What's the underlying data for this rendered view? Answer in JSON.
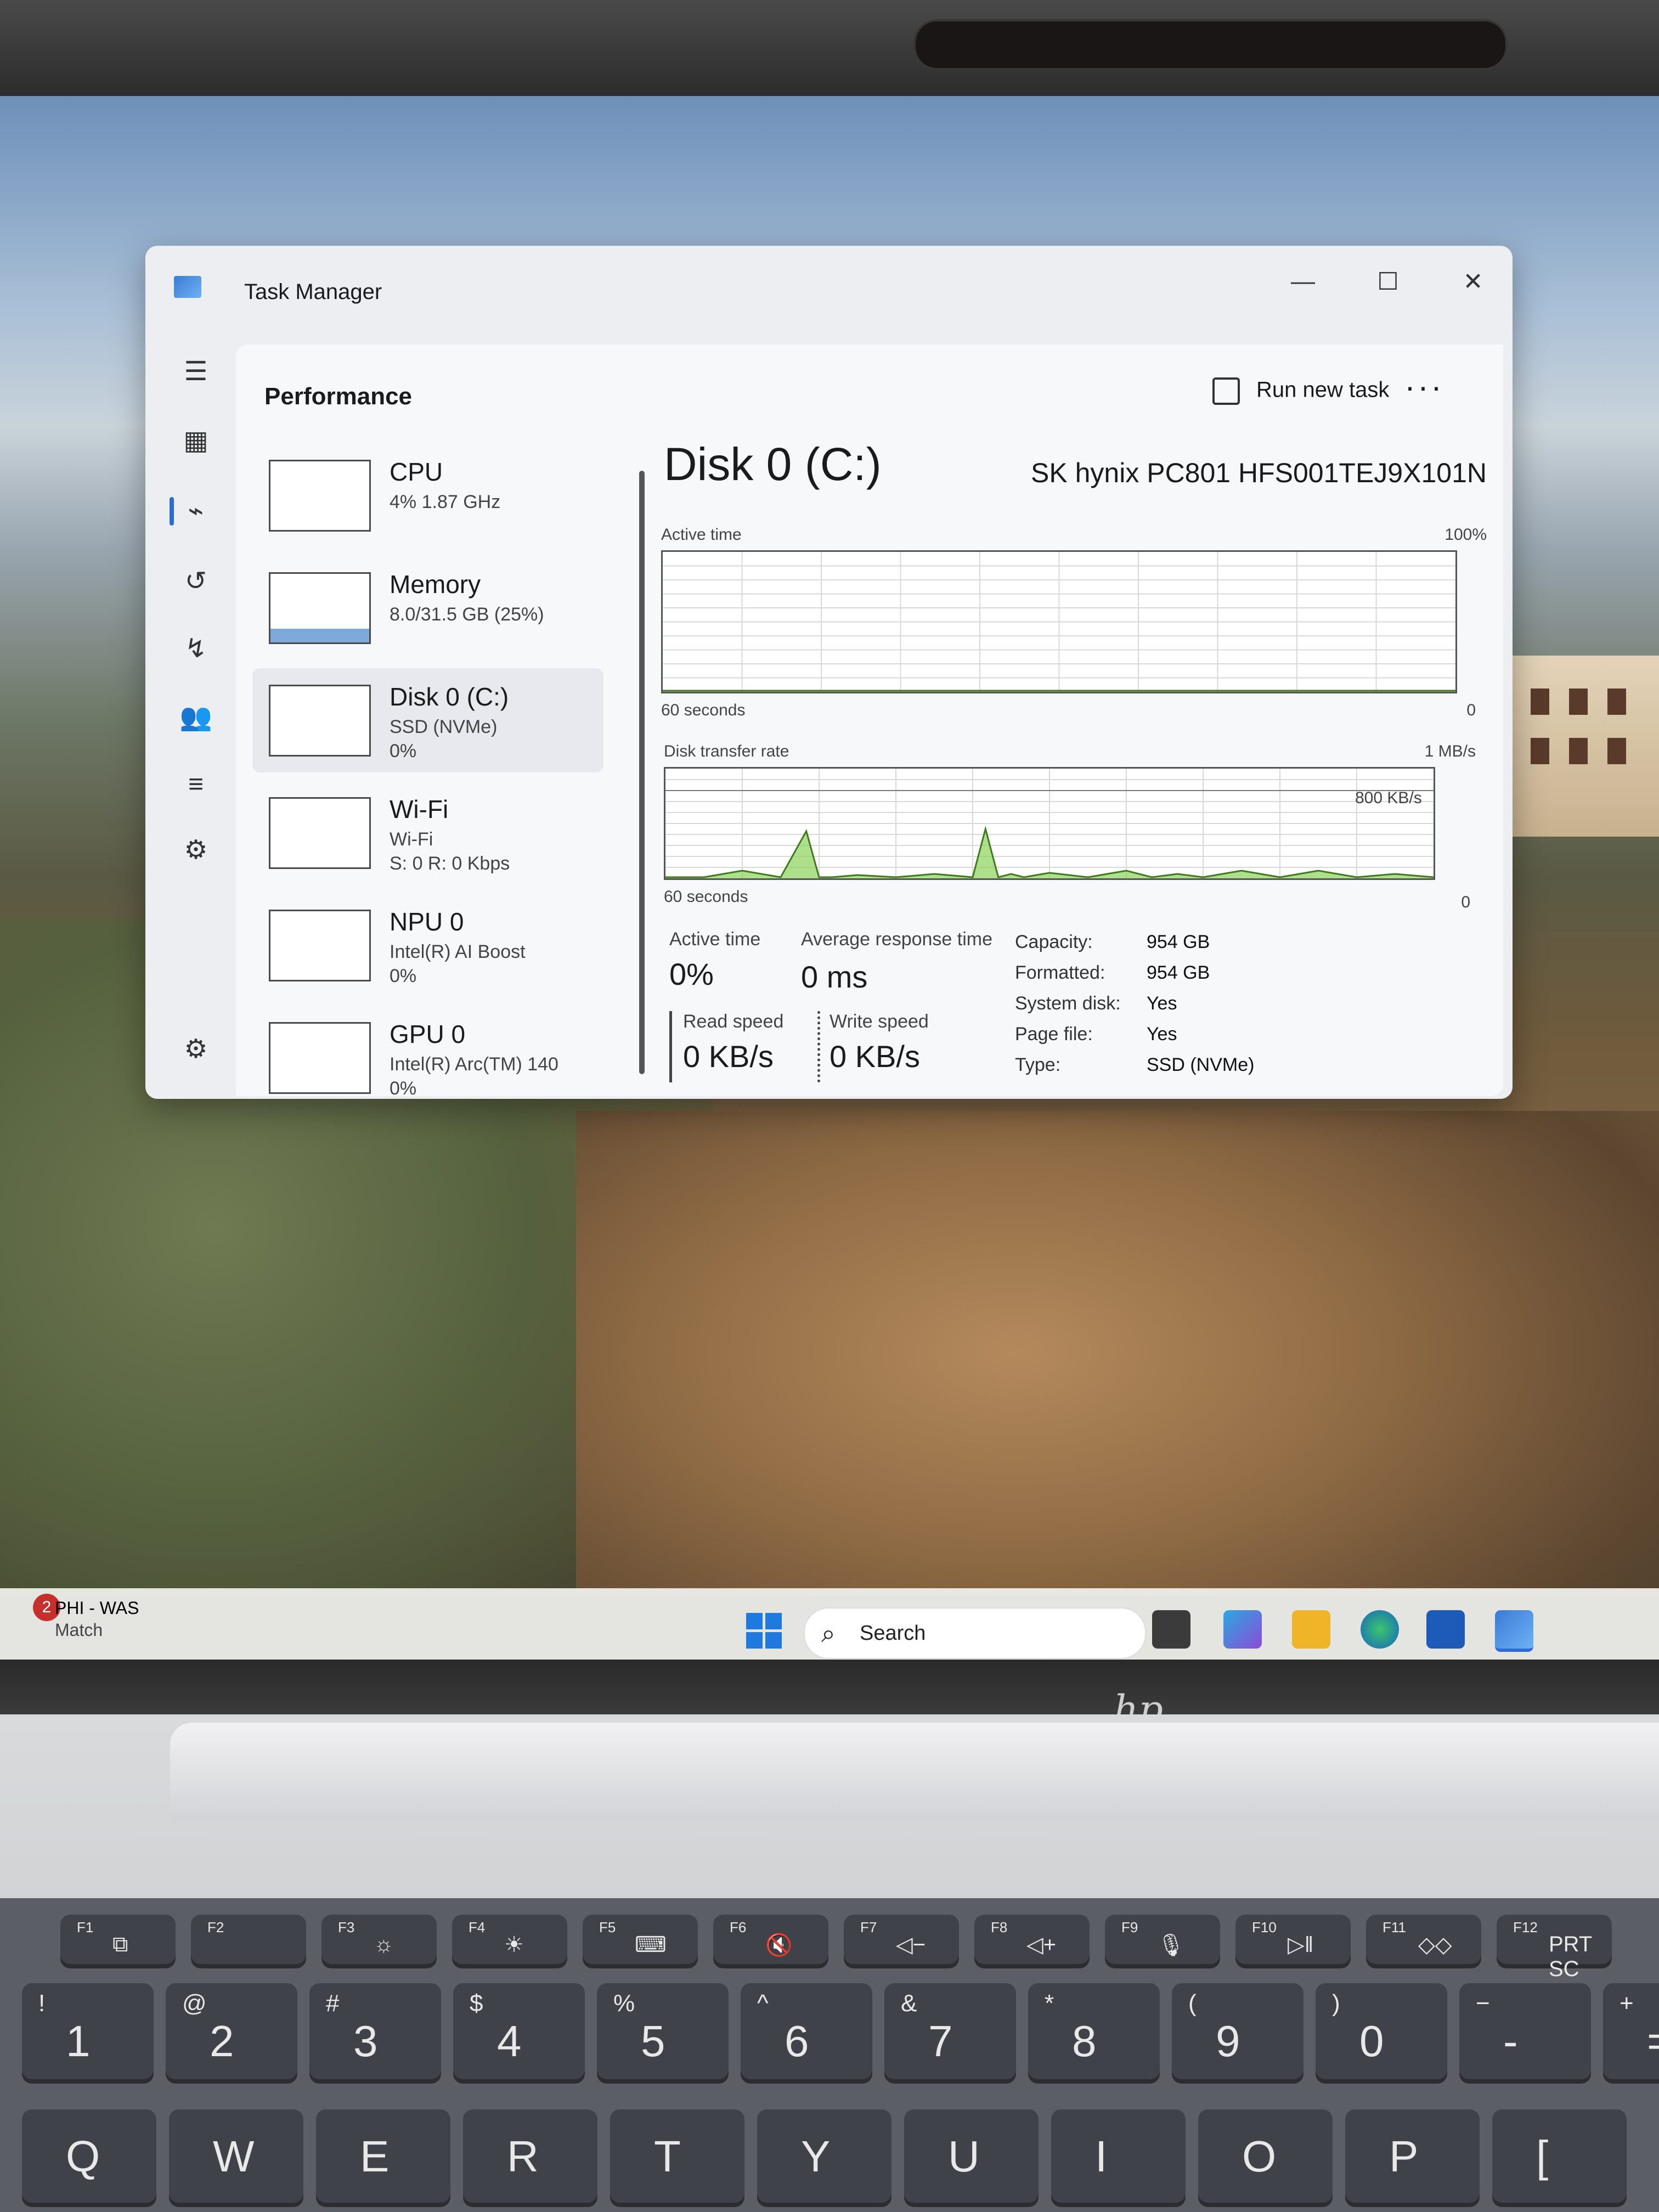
{
  "window": {
    "title": "Task Manager",
    "minimize_glyph": "—",
    "maximize_glyph": "☐",
    "close_glyph": "✕"
  },
  "header": {
    "page_title": "Performance",
    "run_new_task": "Run new task",
    "more_glyph": "···"
  },
  "nav_icons": [
    "hamburger-icon",
    "processes-icon",
    "performance-icon",
    "app-history-icon",
    "startup-icon",
    "users-icon",
    "details-icon",
    "services-icon",
    "settings-icon"
  ],
  "devices": [
    {
      "name": "CPU",
      "line2": "4% 1.87 GHz",
      "line3": ""
    },
    {
      "name": "Memory",
      "line2": "8.0/31.5 GB (25%)",
      "line3": ""
    },
    {
      "name": "Disk 0 (C:)",
      "line2": "SSD (NVMe)",
      "line3": "0%"
    },
    {
      "name": "Wi-Fi",
      "line2": "Wi-Fi",
      "line3": "S: 0 R: 0 Kbps"
    },
    {
      "name": "NPU 0",
      "line2": "Intel(R) AI Boost",
      "line3": "0%"
    },
    {
      "name": "GPU 0",
      "line2": "Intel(R) Arc(TM) 140",
      "line3": "0%"
    }
  ],
  "detail": {
    "title": "Disk 0 (C:)",
    "model": "SK hynix PC801 HFS001TEJ9X101N",
    "active_time_label": "Active time",
    "active_time_max": "100%",
    "active_time_span": "60 seconds",
    "active_time_min": "0",
    "transfer_label": "Disk transfer rate",
    "transfer_max": "1 MB/s",
    "transfer_mid": "800 KB/s",
    "transfer_span": "60 seconds",
    "transfer_min": "0",
    "stats": {
      "active_time_lbl": "Active time",
      "active_time_val": "0%",
      "avg_resp_lbl": "Average response time",
      "avg_resp_val": "0 ms",
      "read_lbl": "Read speed",
      "read_val": "0 KB/s",
      "write_lbl": "Write speed",
      "write_val": "0 KB/s"
    },
    "props": [
      {
        "k": "Capacity:",
        "v": "954 GB"
      },
      {
        "k": "Formatted:",
        "v": "954 GB"
      },
      {
        "k": "System disk:",
        "v": "Yes"
      },
      {
        "k": "Page file:",
        "v": "Yes"
      },
      {
        "k": "Type:",
        "v": "SSD (NVMe)"
      }
    ]
  },
  "taskbar": {
    "news_badge": "2",
    "news_title": "PHI - WAS",
    "news_sub": "Match",
    "search": "Search"
  },
  "laptop": {
    "brand": "hp"
  },
  "keyboard": {
    "fn_row": [
      {
        "fn": "F1",
        "glyph": "⧉"
      },
      {
        "fn": "F2",
        "glyph": ""
      },
      {
        "fn": "F3",
        "glyph": "☼"
      },
      {
        "fn": "F4",
        "glyph": "☀"
      },
      {
        "fn": "F5",
        "glyph": "⌨"
      },
      {
        "fn": "F6",
        "glyph": "🔇"
      },
      {
        "fn": "F7",
        "glyph": "◁−"
      },
      {
        "fn": "F8",
        "glyph": "◁+"
      },
      {
        "fn": "F9",
        "glyph": "🎙"
      },
      {
        "fn": "F10",
        "glyph": "▷‖"
      },
      {
        "fn": "F11",
        "glyph": "◇◇"
      },
      {
        "fn": "F12",
        "glyph": "PRT SC"
      }
    ],
    "num_row": [
      {
        "main": "1",
        "sub": "!"
      },
      {
        "main": "2",
        "sub": "@"
      },
      {
        "main": "3",
        "sub": "#"
      },
      {
        "main": "4",
        "sub": "$"
      },
      {
        "main": "5",
        "sub": "%"
      },
      {
        "main": "6",
        "sub": "^"
      },
      {
        "main": "7",
        "sub": "&"
      },
      {
        "main": "8",
        "sub": "*"
      },
      {
        "main": "9",
        "sub": "("
      },
      {
        "main": "0",
        "sub": ")"
      },
      {
        "main": "-",
        "sub": "−"
      },
      {
        "main": "=",
        "sub": "+"
      }
    ],
    "q_row": [
      "Q",
      "W",
      "E",
      "R",
      "T",
      "Y",
      "U",
      "I",
      "O",
      "P",
      "["
    ]
  },
  "chart_data": [
    {
      "type": "line",
      "title": "Active time",
      "xlabel": "60 seconds",
      "ylim": [
        0,
        100
      ],
      "x": [
        0,
        60
      ],
      "series": [
        {
          "values": [
            0,
            0
          ]
        }
      ]
    },
    {
      "type": "line",
      "title": "Disk transfer rate",
      "xlabel": "60 seconds",
      "ylim": [
        0,
        1000
      ],
      "x": [
        0,
        3,
        6,
        9,
        11,
        12,
        13,
        15,
        18,
        21,
        24,
        25,
        26,
        27,
        28,
        30,
        33,
        36,
        38,
        40,
        42,
        45,
        48,
        51,
        54,
        57,
        60
      ],
      "series": [
        {
          "values": [
            0,
            0,
            60,
            0,
            420,
            0,
            0,
            20,
            0,
            30,
            0,
            440,
            0,
            30,
            0,
            40,
            0,
            60,
            0,
            30,
            0,
            60,
            0,
            60,
            0,
            30,
            0
          ]
        }
      ]
    }
  ]
}
